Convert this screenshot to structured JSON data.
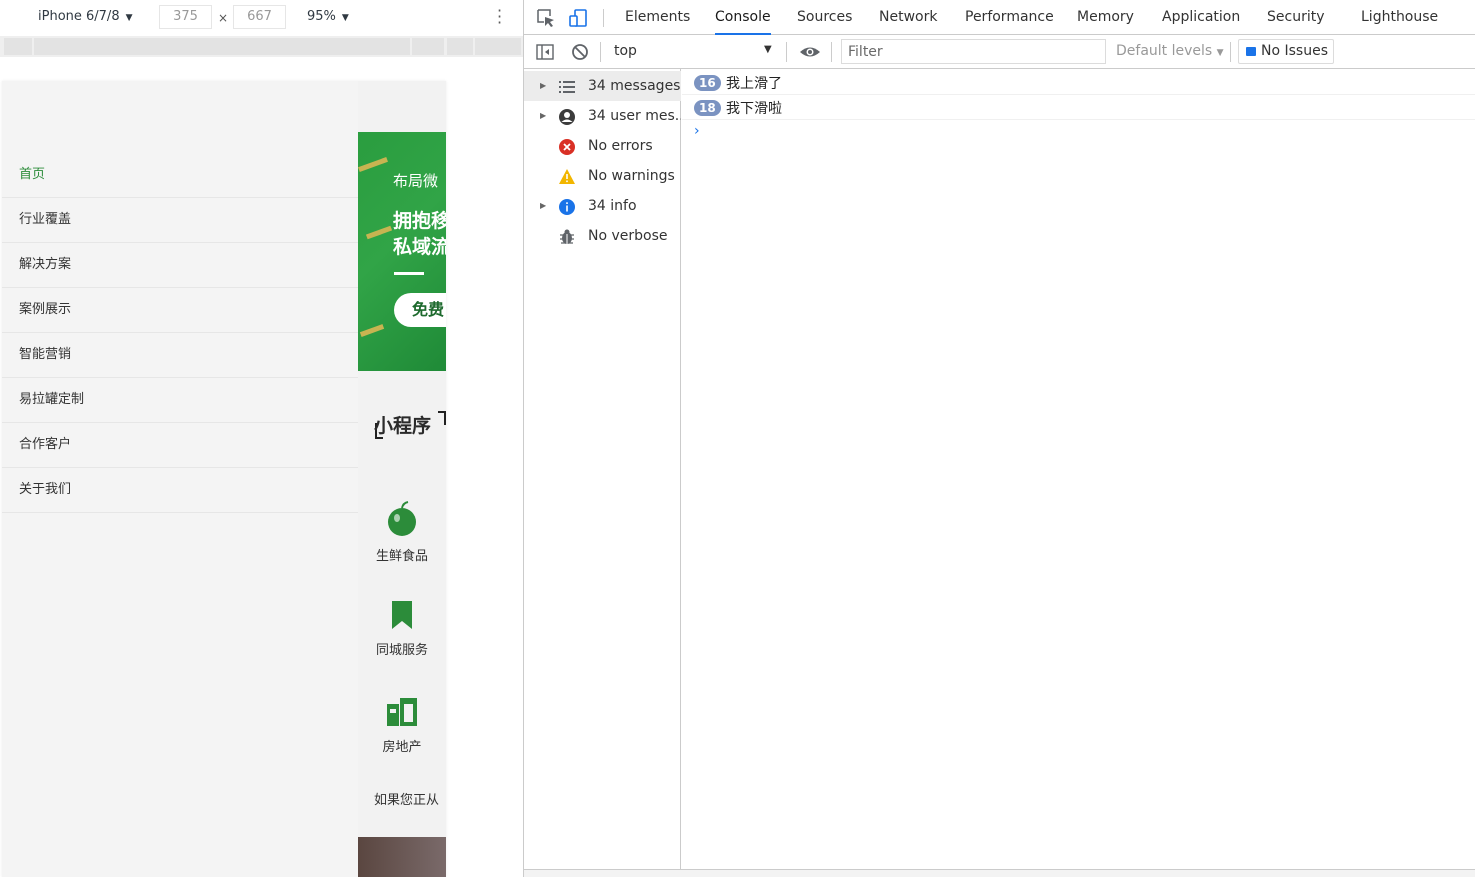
{
  "device_toolbar": {
    "device": "iPhone 6/7/8",
    "width": "375",
    "times": "×",
    "height": "667",
    "zoom": "95%"
  },
  "mobile_page": {
    "menu": {
      "items": [
        {
          "label": "首页",
          "active": true
        },
        {
          "label": "行业覆盖"
        },
        {
          "label": "解决方案"
        },
        {
          "label": "案例展示"
        },
        {
          "label": "智能营销"
        },
        {
          "label": "易拉罐定制"
        },
        {
          "label": "合作客户"
        },
        {
          "label": "关于我们"
        }
      ]
    },
    "banner": {
      "line1": "布局微",
      "line2a": "拥抱移",
      "line2b": "私域流",
      "button": "免费"
    },
    "section_title": "小程序",
    "categories": [
      {
        "label": "生鲜食品",
        "icon": "apple-icon"
      },
      {
        "label": "同城服务",
        "icon": "bookmark-icon"
      },
      {
        "label": "房地产",
        "icon": "building-icon"
      }
    ],
    "more_text": "如果您正从",
    "colors": {
      "accent": "#2c8c3a",
      "banner": "#2a9d3f"
    }
  },
  "devtools": {
    "tabs": [
      "Elements",
      "Console",
      "Sources",
      "Network",
      "Performance",
      "Memory",
      "Application",
      "Security",
      "Lighthouse"
    ],
    "active_tab": "Console",
    "context": "top",
    "filter_placeholder": "Filter",
    "levels": "Default levels",
    "issues": "No Issues",
    "sidebar": [
      {
        "label": "34 messages",
        "icon": "list-icon",
        "expandable": true,
        "selected": true
      },
      {
        "label": "34 user mes...",
        "icon": "user-icon",
        "expandable": true
      },
      {
        "label": "No errors",
        "icon": "error-icon",
        "expandable": false
      },
      {
        "label": "No warnings",
        "icon": "warning-icon",
        "expandable": false
      },
      {
        "label": "34 info",
        "icon": "info-icon",
        "expandable": true
      },
      {
        "label": "No verbose",
        "icon": "bug-icon",
        "expandable": false
      }
    ],
    "messages": [
      {
        "count": "16",
        "text": "我上滑了"
      },
      {
        "count": "18",
        "text": "我下滑啦"
      }
    ],
    "prompt": "›"
  }
}
